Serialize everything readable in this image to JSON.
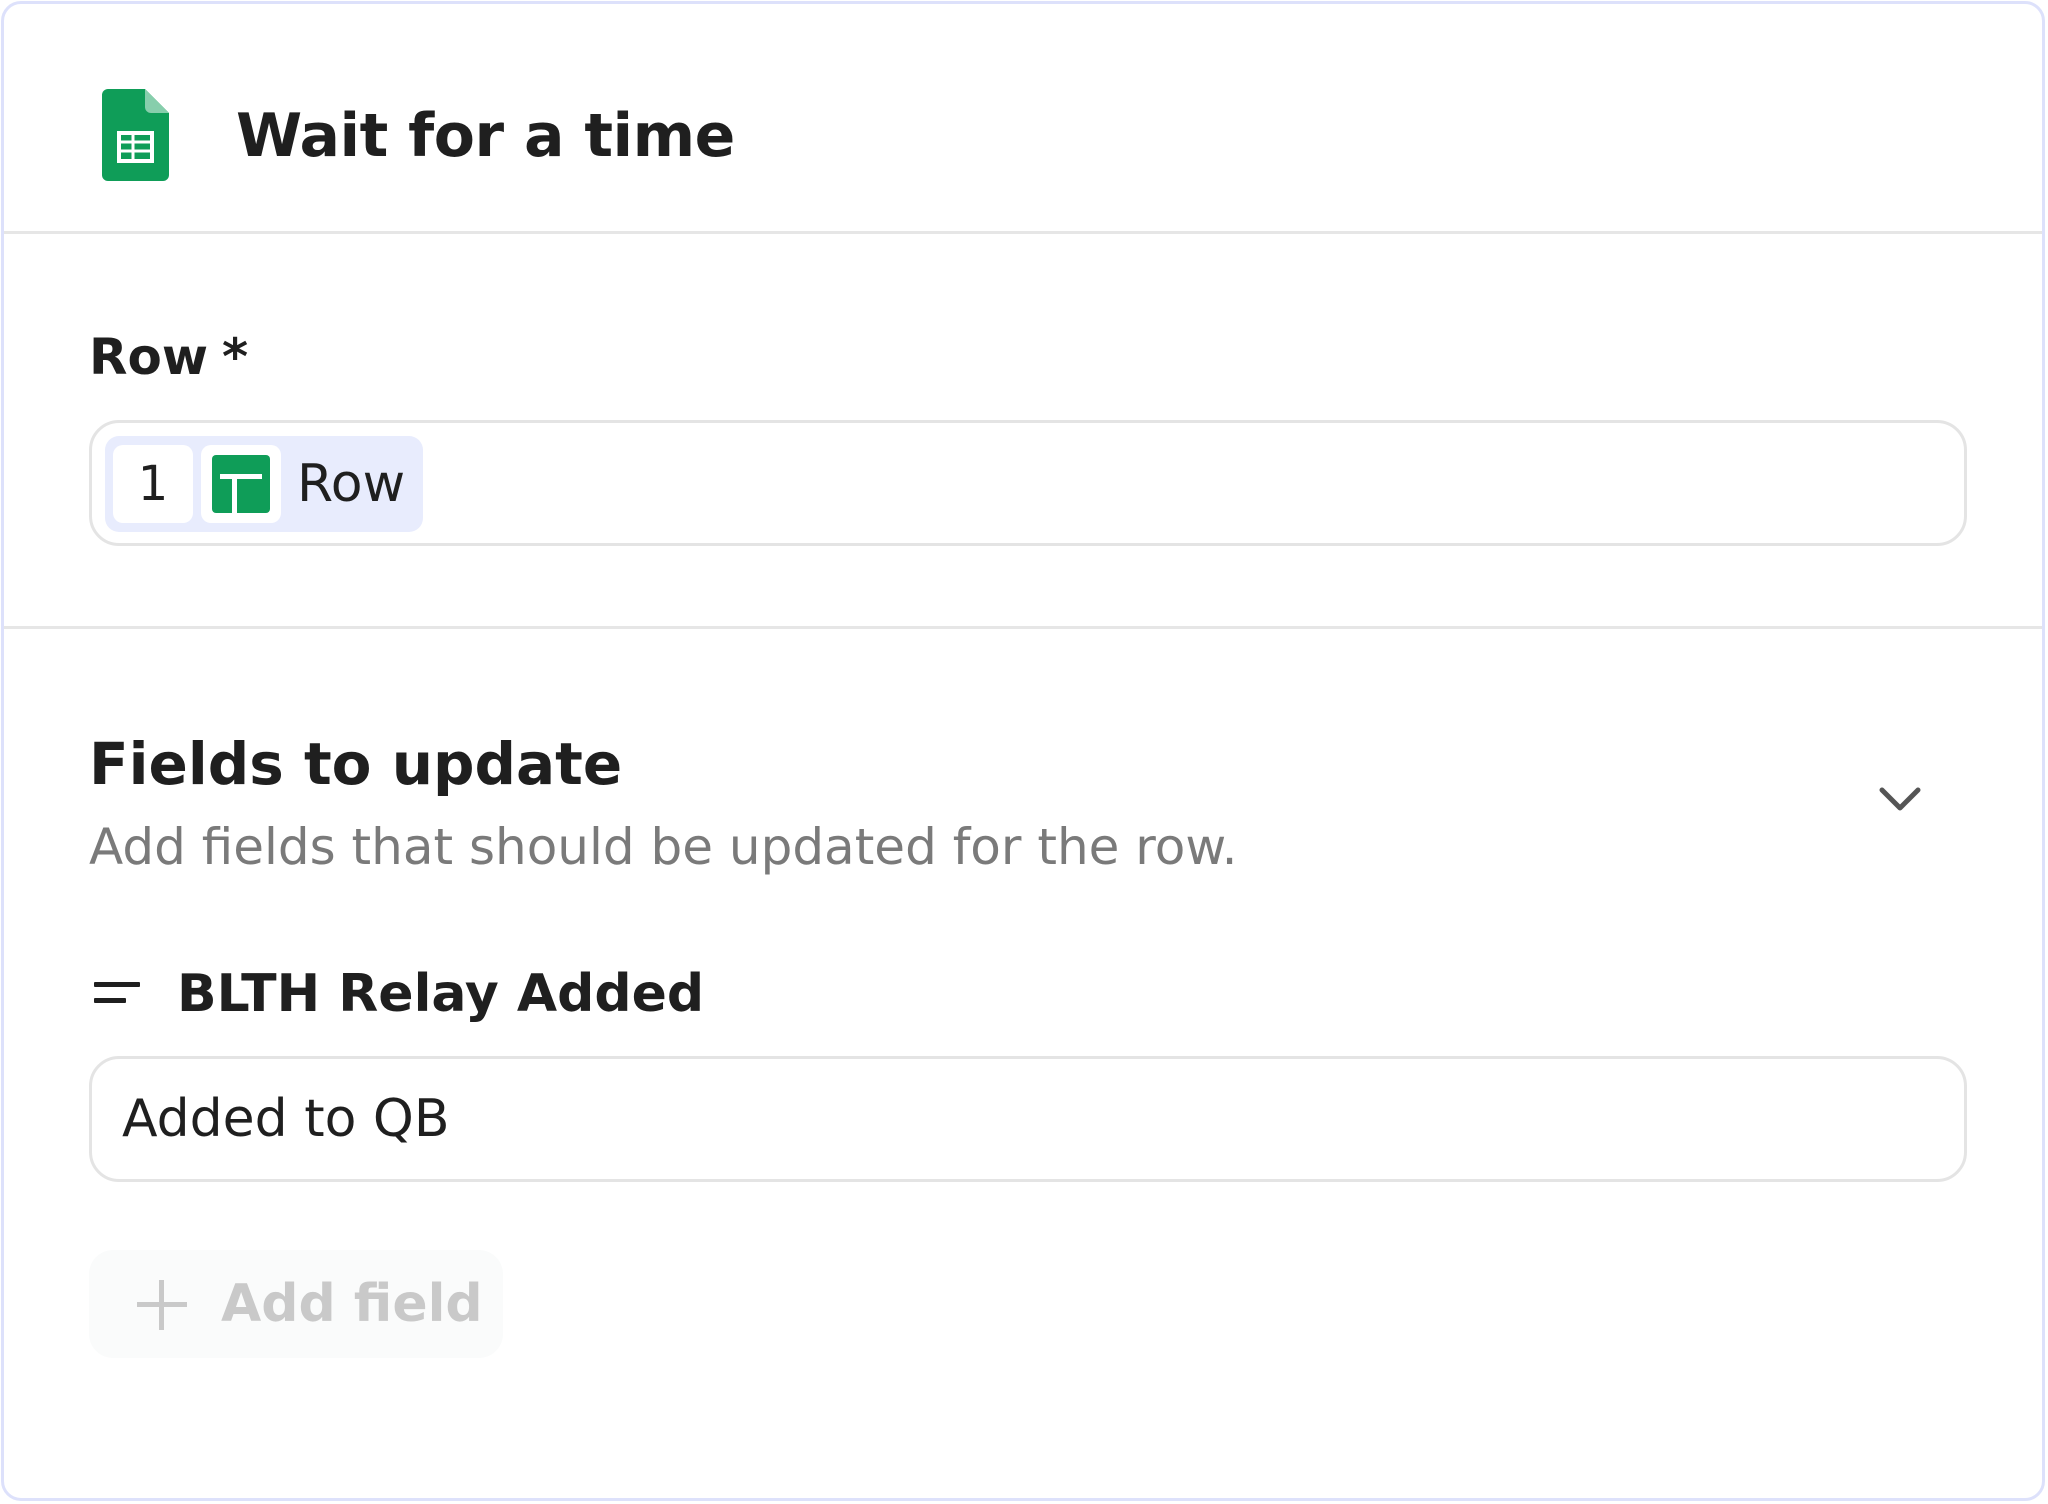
{
  "header": {
    "title": "Wait for a time",
    "app_icon": "google-sheets-icon"
  },
  "row": {
    "label": "Row",
    "required_marker": "*",
    "value_pill": {
      "step_number": "1",
      "icon": "google-sheets-icon",
      "label": "Row"
    }
  },
  "fields_section": {
    "title": "Fields to update",
    "description": "Add fields that should be updated for the row.",
    "collapse_icon": "chevron-down-icon",
    "fields": [
      {
        "name": "BLTH Relay Added",
        "icon": "text-lines-icon",
        "value": "Added to QB"
      }
    ],
    "add_button_label": "Add field"
  },
  "colors": {
    "card_border": "#dde1fb",
    "pill_background": "#e8ecfd",
    "sheets_green": "#0f9d58",
    "muted_text": "#7a7a7a",
    "disabled_text": "#c9c9c9"
  }
}
